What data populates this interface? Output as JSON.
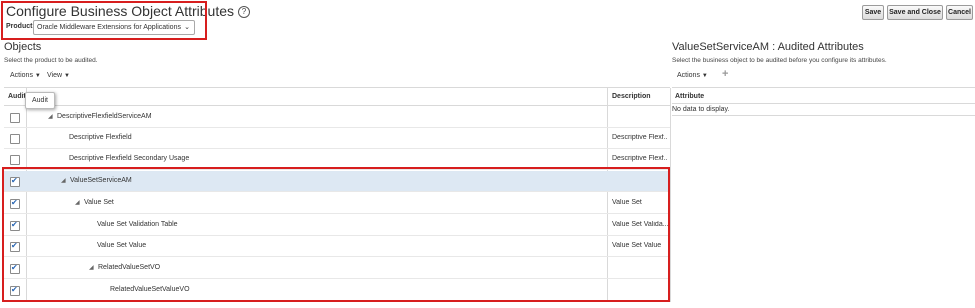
{
  "header": {
    "title": "Configure Business Object Attributes",
    "help_icon": "?",
    "product_label": "Product",
    "product_value": "Oracle Middleware Extensions for Applications",
    "buttons": {
      "save": "Save",
      "save_close": "Save and Close",
      "cancel": "Cancel"
    }
  },
  "objects": {
    "title": "Objects",
    "subtitle": "Select the product to be audited.",
    "toolbar": {
      "actions": "Actions",
      "view": "View"
    },
    "columns": {
      "audit": "Audit",
      "description": "Description"
    },
    "tooltip": "Audit",
    "rows": [
      {
        "name": "DescriptiveFlexfieldServiceAM",
        "description": "",
        "checked": false,
        "expander": "◢"
      },
      {
        "name": "Descriptive Flexfield",
        "description": "Descriptive Flexf...",
        "checked": false,
        "expander": ""
      },
      {
        "name": "Descriptive Flexfield Secondary Usage",
        "description": "Descriptive Flexf...",
        "checked": false,
        "expander": ""
      },
      {
        "name": "ValueSetServiceAM",
        "description": "",
        "checked": true,
        "expander": "◢"
      },
      {
        "name": "Value Set",
        "description": "Value Set",
        "checked": true,
        "expander": "◢"
      },
      {
        "name": "Value Set Validation Table",
        "description": "Value Set Valida...",
        "checked": true,
        "expander": ""
      },
      {
        "name": "Value Set Value",
        "description": "Value Set Value",
        "checked": true,
        "expander": ""
      },
      {
        "name": "RelatedValueSetVO",
        "description": "",
        "checked": true,
        "expander": "◢"
      },
      {
        "name": "RelatedValueSetValueVO",
        "description": "",
        "checked": true,
        "expander": ""
      }
    ]
  },
  "audited": {
    "title": "ValueSetServiceAM : Audited Attributes",
    "subtitle": "Select the business object to be audited before you configure its attributes.",
    "toolbar": {
      "actions": "Actions",
      "add": "+"
    },
    "columns": {
      "attribute": "Attribute"
    },
    "empty": "No data to display."
  },
  "colors": {
    "highlight_box": "#d71e1e",
    "selected_row": "#dde8f3",
    "check": "#2a67b4"
  }
}
